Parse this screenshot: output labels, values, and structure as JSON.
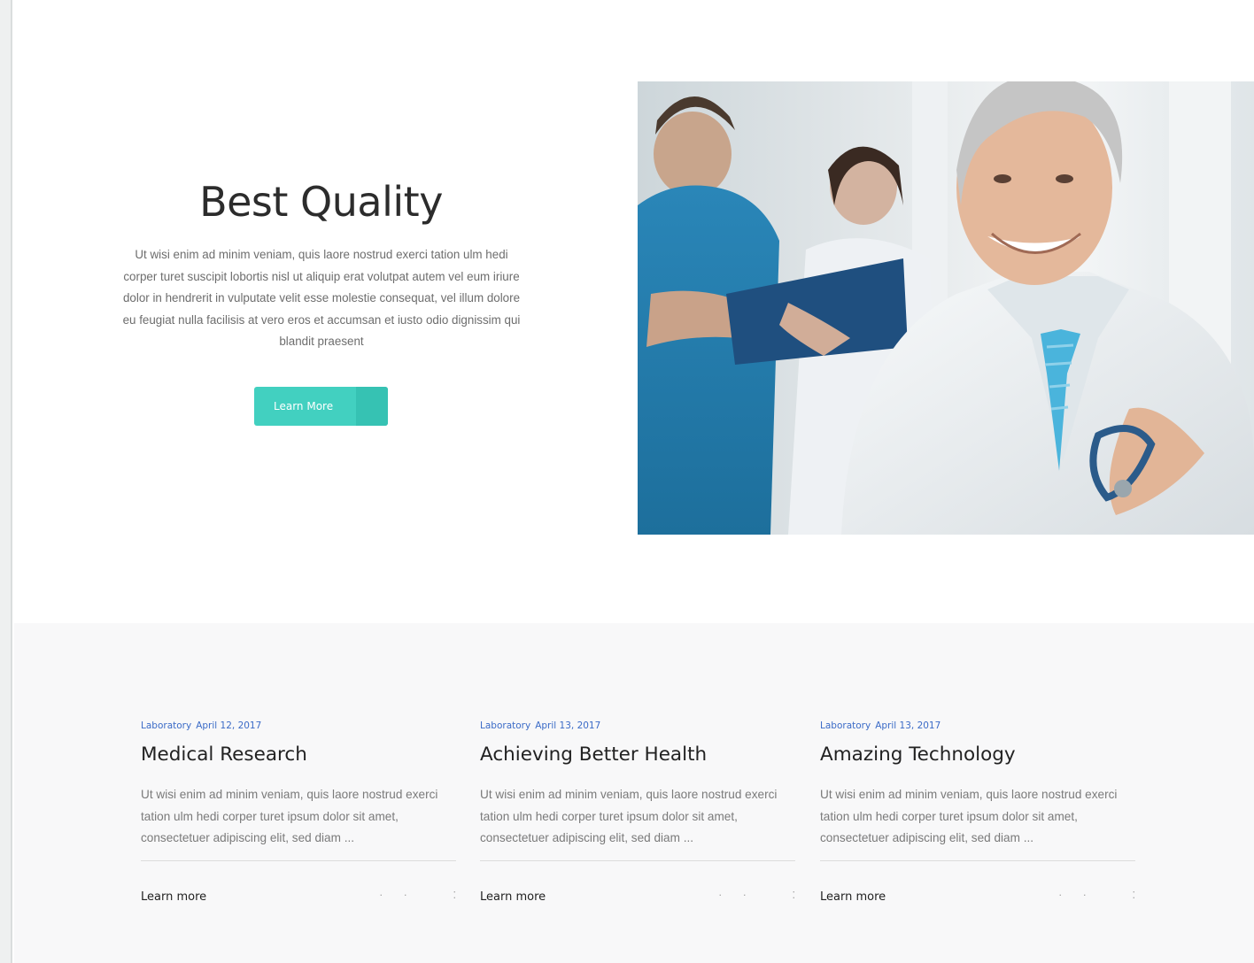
{
  "hero": {
    "title": "Best Quality",
    "text": "Ut wisi enim ad minim veniam, quis laore nostrud exerci tation ulm hedi corper turet suscipit lobortis nisl ut aliquip erat volutpat autem vel eum iriure dolor in hendrerit in vulputate velit esse molestie consequat, vel illum dolore eu feugiat nulla facilisis at vero eros et accumsan et iusto odio dignissim qui blandit praesent",
    "button_label": "Learn More",
    "image": "smiling-doctor-photo"
  },
  "posts": [
    {
      "category": "Laboratory",
      "date": "April 12, 2017",
      "title": "Medical Research",
      "excerpt": "Ut wisi enim ad minim veniam, quis laore nostrud exerci tation ulm hedi corper turet ipsum dolor sit amet, consectetuer adipiscing elit, sed diam ...",
      "link_label": "Learn more"
    },
    {
      "category": "Laboratory",
      "date": "April 13, 2017",
      "title": "Achieving Better Health",
      "excerpt": "Ut wisi enim ad minim veniam, quis laore nostrud exerci tation ulm hedi corper turet ipsum dolor sit amet, consectetuer adipiscing elit, sed diam ...",
      "link_label": "Learn more"
    },
    {
      "category": "Laboratory",
      "date": "April 13, 2017",
      "title": "Amazing Technology",
      "excerpt": "Ut wisi enim ad minim veniam, quis laore nostrud exerci tation ulm hedi corper turet ipsum dolor sit amet, consectetuer adipiscing elit, sed diam ...",
      "link_label": "Learn more"
    }
  ],
  "colors": {
    "accent": "#42d0c0",
    "accent_dark": "#36c2b3",
    "meta_link": "#3b6bc7",
    "section_bg": "#f8f8f9"
  }
}
